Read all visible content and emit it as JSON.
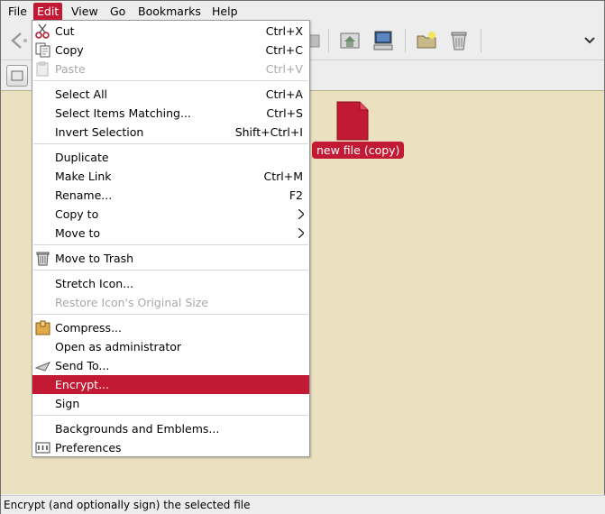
{
  "menubar": {
    "items": [
      {
        "label": "File",
        "mnemonic_index": 0
      },
      {
        "label": "Edit",
        "mnemonic_index": 0
      },
      {
        "label": "View",
        "mnemonic_index": 0
      },
      {
        "label": "Go",
        "mnemonic_index": 0
      },
      {
        "label": "Bookmarks",
        "mnemonic_index": 0
      },
      {
        "label": "Help",
        "mnemonic_index": 0
      }
    ],
    "active": "Edit"
  },
  "toolbar": {
    "icons": [
      "back-icon",
      "home-icon",
      "computer-icon",
      "new-folder-icon",
      "trash-icon",
      "chevron-down-icon"
    ]
  },
  "desktop": {
    "file": {
      "label": "new file (copy)",
      "icon": "document-icon"
    }
  },
  "edit_menu": {
    "items": [
      {
        "label": "Cut",
        "accel": "Ctrl+X",
        "icon": "scissors-icon"
      },
      {
        "label": "Copy",
        "accel": "Ctrl+C",
        "icon": "copy-icon"
      },
      {
        "label": "Paste",
        "accel": "Ctrl+V",
        "icon": "paste-icon",
        "disabled": true
      },
      {
        "label": "Select All",
        "accel": "Ctrl+A"
      },
      {
        "label": "Select Items Matching...",
        "accel": "Ctrl+S"
      },
      {
        "label": "Invert Selection",
        "accel": "Shift+Ctrl+I"
      },
      {
        "label": "Duplicate",
        "accel": ""
      },
      {
        "label": "Make Link",
        "accel": "Ctrl+M"
      },
      {
        "label": "Rename...",
        "accel": "F2"
      },
      {
        "label": "Copy to",
        "accel": "",
        "submenu": true
      },
      {
        "label": "Move to",
        "accel": "",
        "submenu": true
      },
      {
        "label": "Move to Trash",
        "accel": "",
        "icon": "trash-icon"
      },
      {
        "label": "Stretch Icon...",
        "accel": ""
      },
      {
        "label": "Restore Icon's Original Size",
        "accel": "",
        "disabled": true
      },
      {
        "label": "Compress...",
        "accel": "",
        "icon": "archive-icon"
      },
      {
        "label": "Open as administrator",
        "accel": ""
      },
      {
        "label": "Send To...",
        "accel": "",
        "icon": "send-icon"
      },
      {
        "label": "Encrypt...",
        "accel": "",
        "highlighted": true
      },
      {
        "label": "Sign",
        "accel": ""
      },
      {
        "label": "Backgrounds and Emblems...",
        "accel": ""
      },
      {
        "label": "Preferences",
        "accel": "",
        "icon": "preferences-icon"
      }
    ]
  },
  "statusbar": {
    "text": "Encrypt (and optionally sign) the selected file"
  },
  "colors": {
    "accent": "#c21a34",
    "desktop_bg": "#ebe1c0",
    "chrome_bg": "#ededed"
  }
}
